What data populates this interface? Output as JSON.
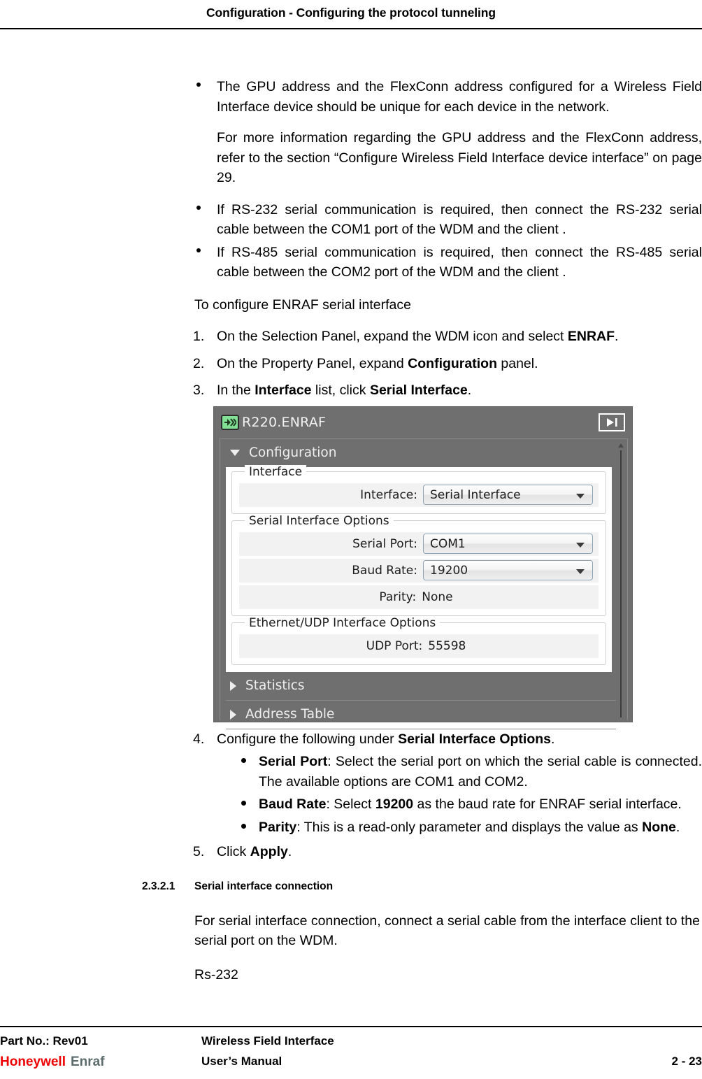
{
  "header": {
    "title": "Configuration - Configuring the protocol tunneling"
  },
  "body": {
    "bullet_gpu": "The GPU address and the FlexConn address configured for a Wireless Field Interface device should be unique for each device in the network.",
    "para_moreinfo_1": "For more information regarding the GPU address and the FlexConn address, refer to the section “Configure Wireless Field Interface device interface” on page 29.",
    "bullet_rs232": "If RS-232 serial communication is required, then connect the RS-232 serial cable between the COM1 port of the WDM and the client .",
    "bullet_rs485": "If RS-485 serial communication is required, then connect the RS-485 serial cable between the COM2 port of the WDM and the client .",
    "lead_to_configure": "To configure ENRAF serial interface",
    "steps": [
      {
        "num": "1.",
        "parts": [
          {
            "t": "On the Selection Panel, expand the WDM icon and select ",
            "b": false
          },
          {
            "t": "ENRAF",
            "b": true
          },
          {
            "t": ".",
            "b": false
          }
        ]
      },
      {
        "num": "2.",
        "parts": [
          {
            "t": "On the Property Panel, expand ",
            "b": false
          },
          {
            "t": "Configuration",
            "b": true
          },
          {
            "t": " panel.",
            "b": false
          }
        ]
      },
      {
        "num": "3.",
        "parts": [
          {
            "t": "In the ",
            "b": false
          },
          {
            "t": "Interface",
            "b": true
          },
          {
            "t": " list, click ",
            "b": false
          },
          {
            "t": "Serial Interface",
            "b": true
          },
          {
            "t": ".",
            "b": false
          }
        ]
      },
      {
        "num": "4.",
        "parts": [
          {
            "t": "Configure the following under ",
            "b": false
          },
          {
            "t": "Serial Interface Options",
            "b": true
          },
          {
            "t": ".",
            "b": false
          }
        ]
      },
      {
        "num": "5.",
        "parts": [
          {
            "t": "Click ",
            "b": false
          },
          {
            "t": "Apply",
            "b": true
          },
          {
            "t": ".",
            "b": false
          }
        ]
      }
    ],
    "sub_bullets": [
      {
        "parts": [
          {
            "t": "Serial Port",
            "b": true
          },
          {
            "t": ": Select the serial port on which the serial cable is connected. The available options are COM1 and COM2.",
            "b": false
          }
        ]
      },
      {
        "parts": [
          {
            "t": "Baud Rate",
            "b": true
          },
          {
            "t": ": Select ",
            "b": false
          },
          {
            "t": "19200",
            "b": true
          },
          {
            "t": " as the baud rate for ENRAF serial interface.",
            "b": false
          }
        ]
      },
      {
        "parts": [
          {
            "t": "Parity",
            "b": true
          },
          {
            "t": ": This is a read-only parameter and displays the value as ",
            "b": false
          },
          {
            "t": "None",
            "b": true
          },
          {
            "t": ".",
            "b": false
          }
        ]
      }
    ],
    "section": {
      "number": "2.3.2.1",
      "title": "Serial interface connection",
      "para": "For serial interface connection, connect a serial cable from the interface client to the serial port on the WDM.",
      "note": "Rs-232"
    }
  },
  "app_screenshot": {
    "title": "R220.ENRAF",
    "title_icon": "device-link-icon",
    "next_button_icon": "step-forward-icon",
    "sections": {
      "configuration": {
        "label": "Configuration",
        "expanded_icon": "triangle-down-icon"
      },
      "statistics": {
        "label": "Statistics",
        "collapsed_icon": "triangle-right-icon"
      },
      "address_table": {
        "label": "Address Table",
        "collapsed_icon": "triangle-right-icon"
      }
    },
    "groups": {
      "interface": {
        "title": "Interface",
        "interface_label": "Interface:",
        "interface_value": "Serial Interface"
      },
      "serial_options": {
        "title": "Serial Interface Options",
        "serial_port_label": "Serial Port:",
        "serial_port_value": "COM1",
        "baud_rate_label": "Baud Rate:",
        "baud_rate_value": "19200",
        "parity_label": "Parity:",
        "parity_value": "None"
      },
      "ethernet_options": {
        "title": "Ethernet/UDP Interface Options",
        "udp_port_label": "UDP Port:",
        "udp_port_value": "55598"
      }
    },
    "colors": {
      "chrome": "#6f6f6f",
      "icon_green": "#81e093",
      "panel": "#ffffff"
    }
  },
  "footer": {
    "part_no": "Part No.: Rev01",
    "logo_honeywell": "Honeywell",
    "logo_enraf": "Enraf",
    "doc_line1": "Wireless Field Interface",
    "doc_line2": "User’s Manual",
    "page_number": "2 - 23",
    "colors": {
      "honeywell_red": "#ee0000",
      "enraf_gray": "#5c6b6b"
    }
  }
}
